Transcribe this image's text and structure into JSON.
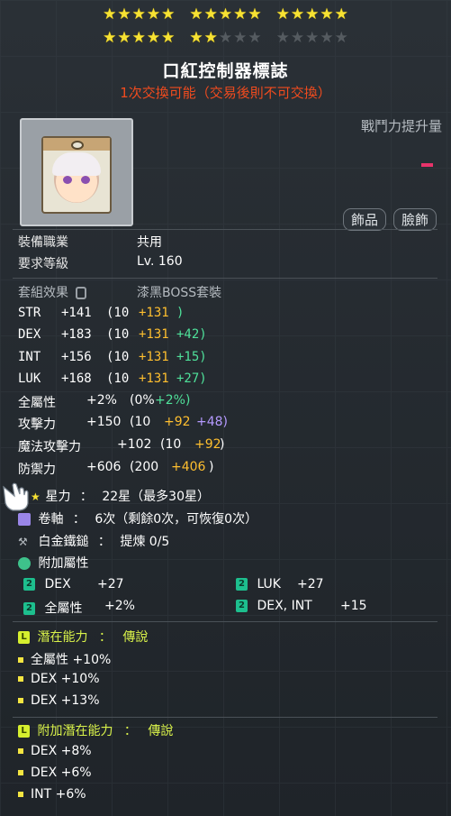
{
  "stars": {
    "rows": [
      [
        5,
        5,
        5
      ],
      [
        5,
        2,
        0
      ]
    ],
    "per_group": 5,
    "on_color": "#f7e233",
    "off_color": "#555b60"
  },
  "item": {
    "name": "口紅控制器標誌",
    "trade_note": "1次交換可能（交易後則不可交換）",
    "combat_power_label": "戰鬥力提升量",
    "categories": [
      "飾品",
      "臉飾"
    ]
  },
  "requirements": {
    "job_label": "裝備職業",
    "job_value": "共用",
    "level_label": "要求等級",
    "level_value": "Lv. 160"
  },
  "set": {
    "label": "套組效果",
    "value": "漆黑BOSS套裝"
  },
  "stats": [
    {
      "name": "STR",
      "total": "+141",
      "base": "(10",
      "star": "+131",
      "bonus": ")"
    },
    {
      "name": "DEX",
      "total": "+183",
      "base": "(10",
      "star": "+131",
      "bonus": "+42)"
    },
    {
      "name": "INT",
      "total": "+156",
      "base": "(10",
      "star": "+131",
      "bonus": "+15)"
    },
    {
      "name": "LUK",
      "total": "+168",
      "base": "(10",
      "star": "+131",
      "bonus": "+27)"
    }
  ],
  "all_stat": {
    "label": "全屬性",
    "total": "+2%",
    "base": "(0%",
    "bonus": "+2%)"
  },
  "attack": {
    "label": "攻擊力",
    "total": "+150",
    "base": "(10",
    "star": "+92",
    "bonus": "+48)"
  },
  "magic_attack": {
    "label": "魔法攻擊力",
    "total": "+102",
    "base": "(10",
    "star": "+92",
    "bonus": ")"
  },
  "defense": {
    "label": "防禦力",
    "total": "+606",
    "base": "(200",
    "star": "+406",
    "bonus": ")"
  },
  "star_force": {
    "label": "星力",
    "sep": "：",
    "value": "22星（最多30星）"
  },
  "scroll": {
    "label": "卷軸",
    "sep": "：",
    "value": "6次（剩餘0次，可恢復0次）"
  },
  "hammer": {
    "label": "白金鐵鎚",
    "sep": "：",
    "value": "提煉 0/5"
  },
  "flame": {
    "label": "附加屬性",
    "items": [
      {
        "name": "DEX",
        "value": "+27"
      },
      {
        "name": "LUK",
        "value": "+27"
      },
      {
        "name": "全屬性",
        "value": "+2%"
      },
      {
        "name": "DEX, INT",
        "value": "+15"
      }
    ]
  },
  "potential": {
    "label": "潛在能力",
    "sep": "：",
    "grade": "傳說",
    "lines": [
      "全屬性 +10%",
      "DEX +10%",
      "DEX +13%"
    ]
  },
  "additional_potential": {
    "label": "附加潛在能力",
    "sep": "：",
    "grade": "傳說",
    "lines": [
      "DEX +8%",
      "DEX +6%",
      "INT +6%"
    ]
  },
  "colors": {
    "title": "#ffffff",
    "trade": "#f04b1e",
    "star_bonus": "#ffbf2f",
    "flame_bonus": "#4fe19a",
    "potential": "#d9f24a",
    "combat_bar": "#e8336a"
  }
}
